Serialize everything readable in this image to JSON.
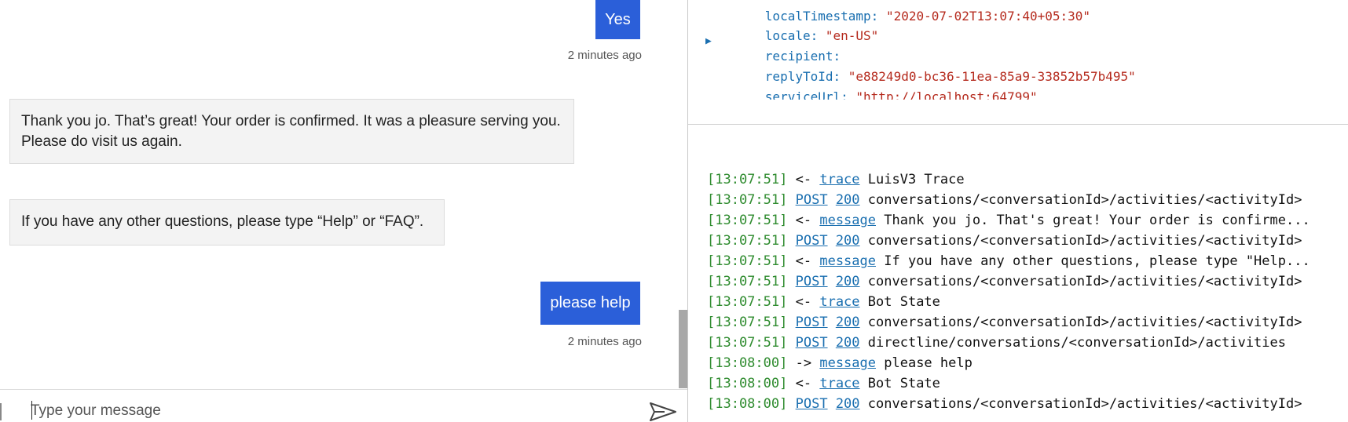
{
  "chat": {
    "messages": [
      {
        "from": "user",
        "text": "Yes",
        "time": "2 minutes ago"
      },
      {
        "from": "bot",
        "text": "Thank you jo. That’s great! Your order is confirmed. It was a pleasure serving you. Please do visit us again."
      },
      {
        "from": "bot",
        "text": "If you have any other questions, please type “Help” or “FAQ”."
      },
      {
        "from": "user",
        "text": "please help",
        "time": "2 minutes ago"
      }
    ],
    "input_placeholder": "Type your message"
  },
  "inspector": {
    "json_lines": [
      {
        "key": "localTimestamp:",
        "value": "\"2020-07-02T13:07:40+05:30\""
      },
      {
        "key": "locale:",
        "value": "\"en-US\""
      },
      {
        "key": "recipient:",
        "value": "",
        "expandable": true
      },
      {
        "key": "replyToId:",
        "value": "\"e88249d0-bc36-11ea-85a9-33852b57b495\""
      },
      {
        "key": "serviceUrl:",
        "value": "\"http://localhost:64799\""
      }
    ]
  },
  "log": {
    "rows": [
      {
        "time": "[13:07:51]",
        "dir": "<-",
        "link": "trace",
        "text": "LuisV3 Trace"
      },
      {
        "time": "[13:07:51]",
        "link": "POST",
        "status": "200",
        "text": "conversations/<conversationId>/activities/<activityId>"
      },
      {
        "time": "[13:07:51]",
        "dir": "<-",
        "link": "message",
        "text": "Thank you jo. That's great! Your order is confirme..."
      },
      {
        "time": "[13:07:51]",
        "link": "POST",
        "status": "200",
        "text": "conversations/<conversationId>/activities/<activityId>"
      },
      {
        "time": "[13:07:51]",
        "dir": "<-",
        "link": "message",
        "text": "If you have any other questions, please type \"Help..."
      },
      {
        "time": "[13:07:51]",
        "link": "POST",
        "status": "200",
        "text": "conversations/<conversationId>/activities/<activityId>"
      },
      {
        "time": "[13:07:51]",
        "dir": "<-",
        "link": "trace",
        "text": "Bot State"
      },
      {
        "time": "[13:07:51]",
        "link": "POST",
        "status": "200",
        "text": "conversations/<conversationId>/activities/<activityId>"
      },
      {
        "time": "[13:07:51]",
        "link": "POST",
        "status": "200",
        "text": "directline/conversations/<conversationId>/activities"
      },
      {
        "time": "[13:08:00]",
        "dir": "->",
        "link": "message",
        "text": "please help"
      },
      {
        "time": "[13:08:00]",
        "dir": "<-",
        "link": "trace",
        "text": "Bot State"
      },
      {
        "time": "[13:08:00]",
        "link": "POST",
        "status": "200",
        "text": "conversations/<conversationId>/activities/<activityId>"
      }
    ]
  }
}
